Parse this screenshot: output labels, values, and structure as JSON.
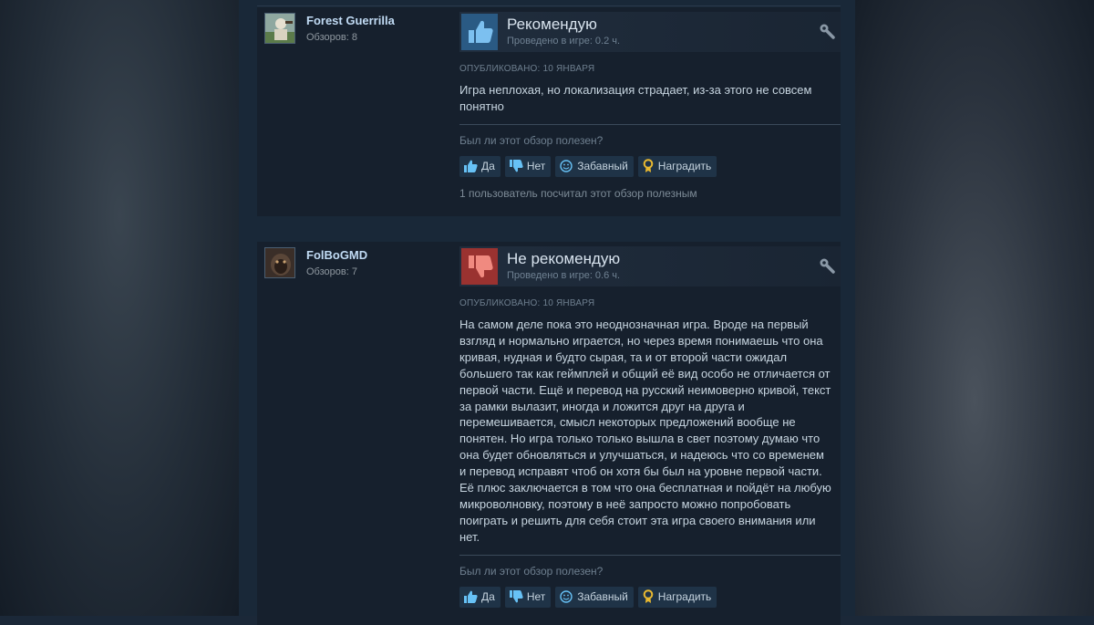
{
  "reviews": [
    {
      "author": {
        "name": "Forest Guerrilla",
        "count": "Обзоров: 8",
        "avatar": "avatar-image"
      },
      "verdict": "Рекомендую",
      "verdict_icon": "thumbs-up-icon",
      "hours": "Проведено в игре: 0.2 ч.",
      "posted": "ОПУБЛИКОВАНО: 10 ЯНВАРЯ",
      "text": "Игра неплохая, но локализация страдает, из-за этого не совсем понятно",
      "helpful_question": "Был ли этот обзор полезен?",
      "buttons": {
        "yes": "Да",
        "no": "Нет",
        "funny": "Забавный",
        "award": "Наградить"
      },
      "helpful_count": "1 пользователь посчитал этот обзор полезным"
    },
    {
      "author": {
        "name": "FolBoGMD",
        "count": "Обзоров: 7",
        "avatar": "avatar-image"
      },
      "verdict": "Не рекомендую",
      "verdict_icon": "thumbs-down-icon",
      "hours": "Проведено в игре: 0.6 ч.",
      "posted": "ОПУБЛИКОВАНО: 10 ЯНВАРЯ",
      "text": "На самом деле пока это неоднозначная игра. Вроде на первый взгляд и нормально играется, но через время понимаешь что она кривая, нудная и будто сырая, та и от второй части ожидал большего так как геймплей и общий её вид особо не отличается от первой части. Ещё и перевод на русский неимоверно кривой, текст за рамки вылазит, иногда и ложится друг на друга и перемешивается, смысл некоторых предложений вообще не понятен. Но игра только только вышла в свет поэтому думаю что она будет обновляться и улучшаться, и надеюсь что со временем и перевод исправят чтоб он хотя бы был на уровне первой части. Её плюс заключается в том что она бесплатная и пойдёт на любую микроволновку, поэтому в неё запросто можно попробовать поиграть и решить для себя стоит эта игра своего внимания или нет.",
      "helpful_question": "Был ли этот обзор полезен?",
      "buttons": {
        "yes": "Да",
        "no": "Нет",
        "funny": "Забавный",
        "award": "Наградить"
      }
    }
  ],
  "colors": {
    "page_bg": "#1b2838",
    "review_bg": "#16202d",
    "link_blue": "#66c0f4",
    "recommend": "#2a5a84",
    "not_recommend": "#9a3230"
  }
}
